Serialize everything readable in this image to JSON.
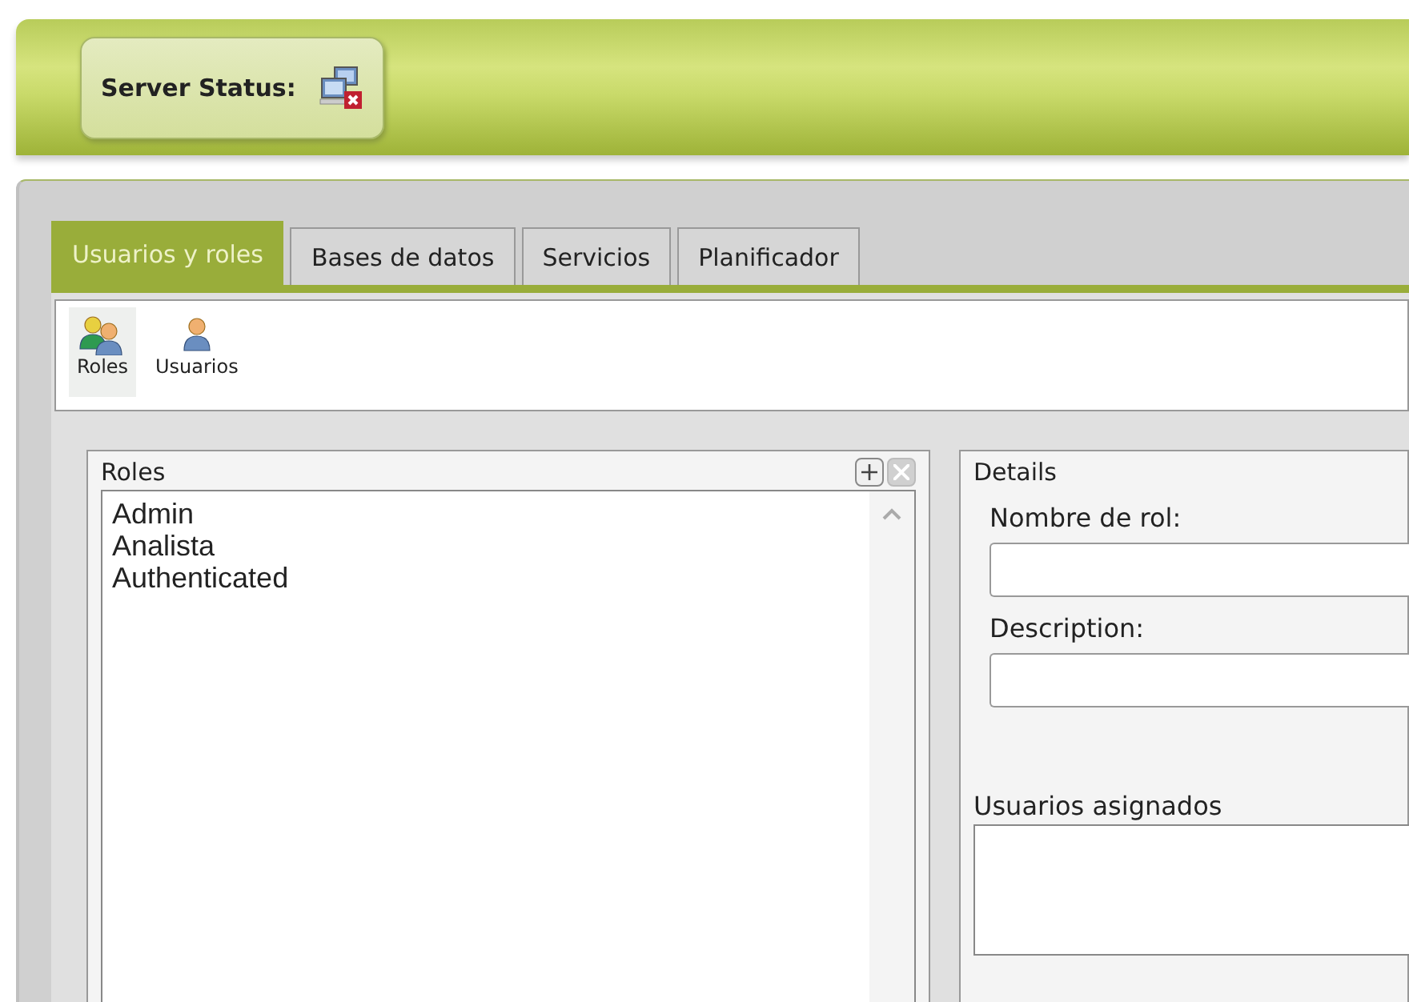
{
  "server_status": {
    "label": "Server Status:"
  },
  "tabs": [
    {
      "label": "Usuarios y roles",
      "selected": true
    },
    {
      "label": "Bases de datos",
      "selected": false
    },
    {
      "label": "Servicios",
      "selected": false
    },
    {
      "label": "Planificador",
      "selected": false
    }
  ],
  "toolbar": [
    {
      "label": "Roles",
      "kind": "group",
      "selected": true
    },
    {
      "label": "Usuarios",
      "kind": "user",
      "selected": false
    }
  ],
  "roles_panel": {
    "title": "Roles",
    "items": [
      {
        "label": "Admin"
      },
      {
        "label": "Analista"
      },
      {
        "label": "Authenticated"
      }
    ]
  },
  "details": {
    "title": "Details",
    "fields": [
      {
        "label": "Nombre de rol:"
      },
      {
        "label": "Description:"
      }
    ],
    "assigned_title": "Usuarios asignados"
  }
}
